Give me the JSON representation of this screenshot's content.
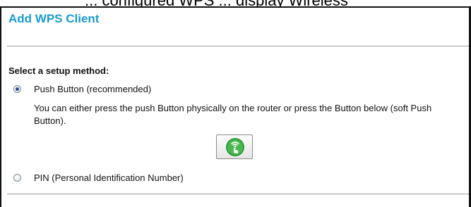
{
  "header": {
    "cut_off_text": "... configured WPS ... display Wireless"
  },
  "page": {
    "title": "Add WPS Client",
    "section_label": "Select a setup method:"
  },
  "options": {
    "push_button": {
      "label": "Push Button (recommended)",
      "selected": true,
      "description": "You can either press the push Button physically on the router or press the Button below (soft Push Button)."
    },
    "pin": {
      "label": "PIN (Personal Identification Number)",
      "selected": false
    }
  },
  "wps_button": {
    "icon": "wps-push-icon",
    "color": "#3aa640"
  },
  "colors": {
    "title": "#1a9bd0",
    "radio_dot": "#2c4a8a"
  }
}
